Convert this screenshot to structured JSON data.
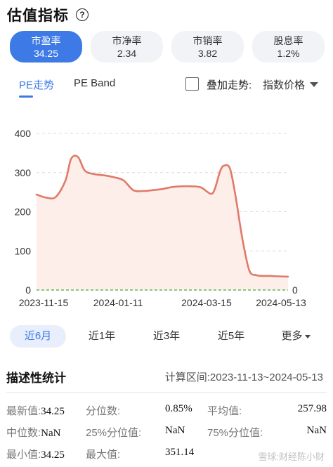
{
  "header": {
    "title": "估值指标",
    "help_symbol": "?"
  },
  "metrics": [
    {
      "label": "市盈率",
      "value": "34.25",
      "active": true
    },
    {
      "label": "市净率",
      "value": "2.34",
      "active": false
    },
    {
      "label": "市销率",
      "value": "3.82",
      "active": false
    },
    {
      "label": "股息率",
      "value": "1.2%",
      "active": false
    }
  ],
  "tabs": [
    {
      "label": "PE走势",
      "active": true
    },
    {
      "label": "PE Band",
      "active": false
    }
  ],
  "overlay": {
    "label": "叠加走势:",
    "select_value": "指数价格",
    "checked": false
  },
  "chart_data": {
    "type": "area",
    "title": "",
    "xlabel": "",
    "ylabel": "",
    "ylim": [
      0,
      400
    ],
    "y_ticks": [
      "0",
      "100",
      "200",
      "300",
      "400"
    ],
    "y2_ticks": [
      "0"
    ],
    "x_ticks": [
      "2023-11-15",
      "2024-01-11",
      "2024-03-15",
      "2024-05-13"
    ],
    "grid": true,
    "line_color": "#e07a68",
    "fill_color": "#fdeeea",
    "baseline_color": "#5cb85c",
    "series": [
      {
        "x": [
          "2023-11-13",
          "2023-11-20",
          "2023-11-27",
          "2023-12-04",
          "2023-12-08",
          "2023-12-13",
          "2023-12-18",
          "2023-12-25",
          "2024-01-01",
          "2024-01-08",
          "2024-01-15",
          "2024-01-22",
          "2024-01-29",
          "2024-02-05",
          "2024-02-12",
          "2024-02-19",
          "2024-02-26",
          "2024-03-04",
          "2024-03-11",
          "2024-03-18",
          "2024-03-21",
          "2024-03-25",
          "2024-03-28",
          "2024-04-01",
          "2024-04-05",
          "2024-04-10",
          "2024-04-15",
          "2024-04-20",
          "2024-04-25",
          "2024-04-30",
          "2024-05-06",
          "2024-05-13"
        ],
        "values": [
          244,
          236,
          238,
          280,
          335,
          340,
          305,
          296,
          293,
          288,
          280,
          255,
          253,
          255,
          258,
          263,
          265,
          265,
          262,
          246,
          258,
          305,
          318,
          310,
          240,
          130,
          50,
          38,
          36,
          36,
          35,
          34.25
        ]
      }
    ]
  },
  "periods": [
    {
      "label": "近6月",
      "active": true
    },
    {
      "label": "近1年",
      "active": false
    },
    {
      "label": "近3年",
      "active": false
    },
    {
      "label": "近5年",
      "active": false
    },
    {
      "label": "更多",
      "active": false
    }
  ],
  "stats": {
    "title": "描述性统计",
    "range": "计算区间:2023-11-13~2024-05-13",
    "rows": [
      [
        {
          "k": "最新值:",
          "v": "34.25"
        },
        {
          "k": "分位数:",
          "v": "0.85%"
        },
        {
          "k": "平均值:",
          "v": "257.98"
        }
      ],
      [
        {
          "k": "中位数:",
          "v": "NaN"
        },
        {
          "k": "25%分位值:",
          "v": "NaN"
        },
        {
          "k": "75%分位值:",
          "v": "NaN"
        }
      ],
      [
        {
          "k": "最小值:",
          "v": "34.25"
        },
        {
          "k": "最大值:",
          "v": "351.14"
        }
      ]
    ]
  },
  "watermark": "雪球:财经陈小财"
}
